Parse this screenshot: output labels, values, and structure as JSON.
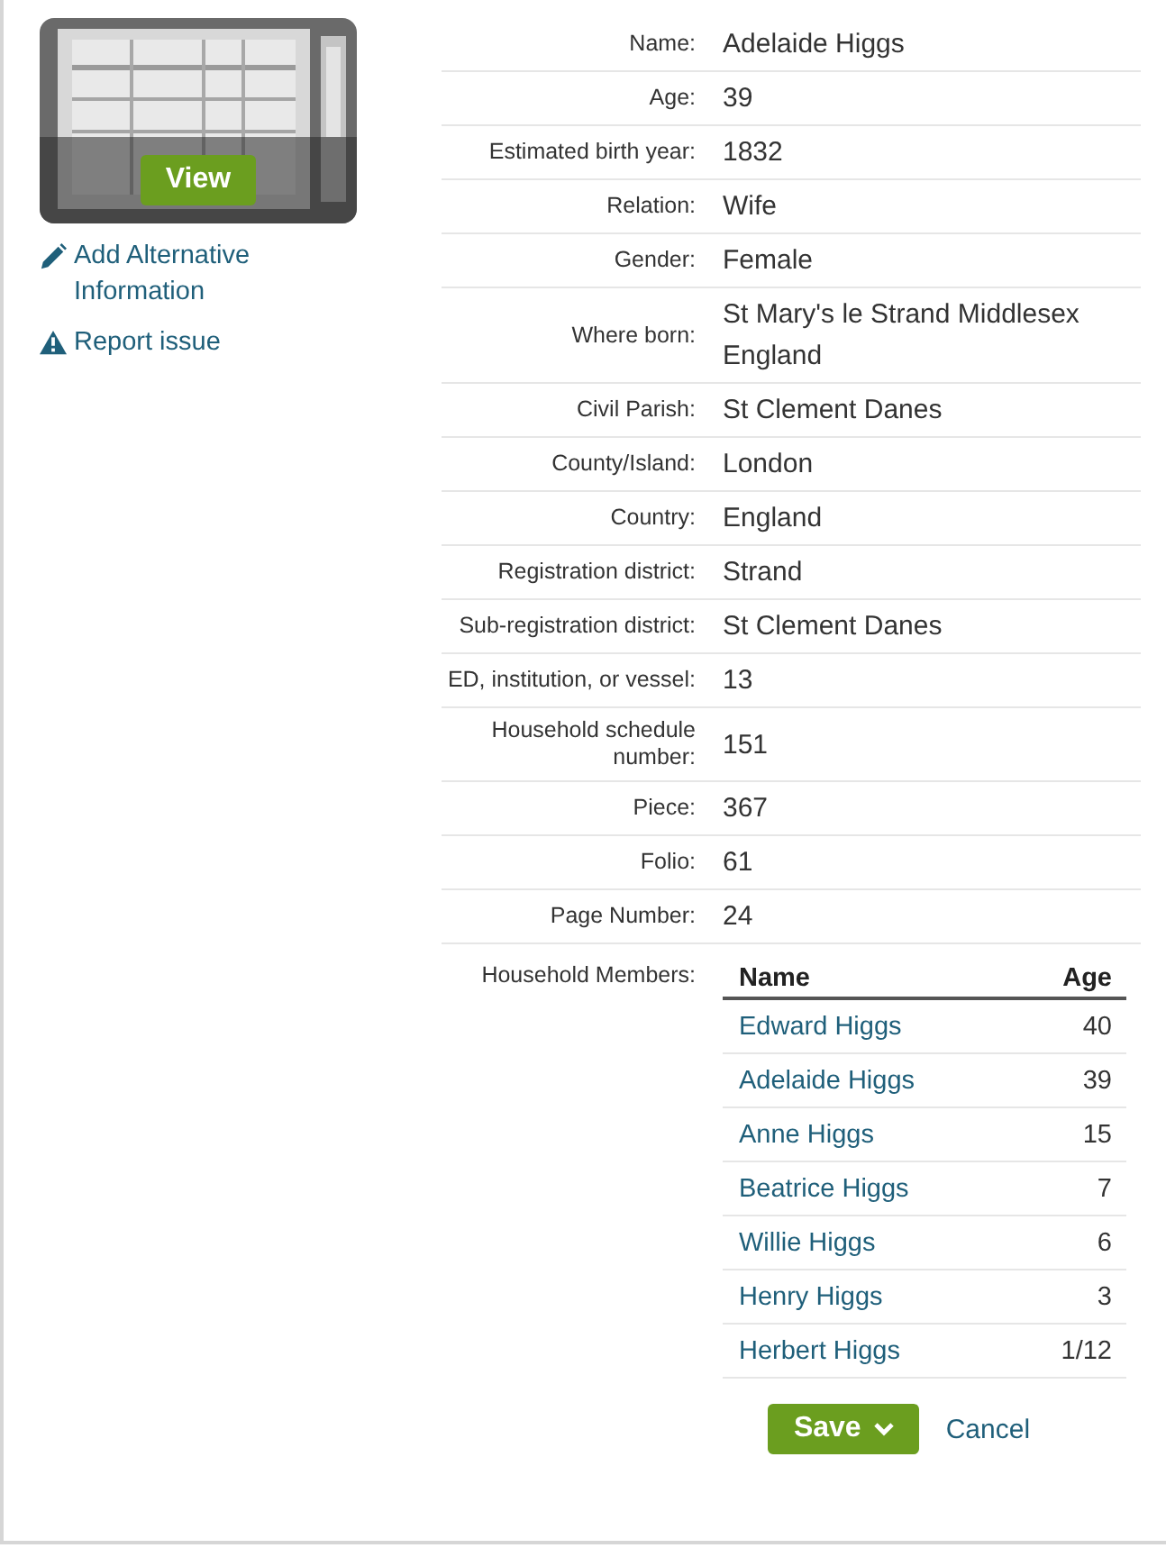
{
  "sidebar": {
    "view_button": "View",
    "links": [
      {
        "kind": "edit",
        "label": "Add Alternative Information"
      },
      {
        "kind": "report",
        "label": "Report issue"
      }
    ]
  },
  "fields": [
    {
      "label": "Name:",
      "value": "Adelaide Higgs"
    },
    {
      "label": "Age:",
      "value": "39"
    },
    {
      "label": "Estimated birth year:",
      "value": "1832"
    },
    {
      "label": "Relation:",
      "value": "Wife"
    },
    {
      "label": "Gender:",
      "value": "Female"
    },
    {
      "label": "Where born:",
      "value": "St Mary's le Strand Middlesex England"
    },
    {
      "label": "Civil Parish:",
      "value": "St Clement Danes"
    },
    {
      "label": "County/Island:",
      "value": "London"
    },
    {
      "label": "Country:",
      "value": "England"
    },
    {
      "label": "Registration district:",
      "value": "Strand"
    },
    {
      "label": "Sub-registration district:",
      "value": "St Clement Danes"
    },
    {
      "label": "ED, institution, or vessel:",
      "value": "13"
    },
    {
      "label": "Household schedule number:",
      "value": "151"
    },
    {
      "label": "Piece:",
      "value": "367"
    },
    {
      "label": "Folio:",
      "value": "61"
    },
    {
      "label": "Page Number:",
      "value": "24"
    }
  ],
  "household": {
    "label": "Household Members:",
    "columns": [
      "Name",
      "Age"
    ],
    "rows": [
      {
        "name": "Edward Higgs",
        "age": "40"
      },
      {
        "name": "Adelaide Higgs",
        "age": "39"
      },
      {
        "name": "Anne Higgs",
        "age": "15"
      },
      {
        "name": "Beatrice Higgs",
        "age": "7"
      },
      {
        "name": "Willie Higgs",
        "age": "6"
      },
      {
        "name": "Henry Higgs",
        "age": "3"
      },
      {
        "name": "Herbert Higgs",
        "age": "1/12"
      }
    ]
  },
  "actions": {
    "save": "Save",
    "cancel": "Cancel"
  }
}
